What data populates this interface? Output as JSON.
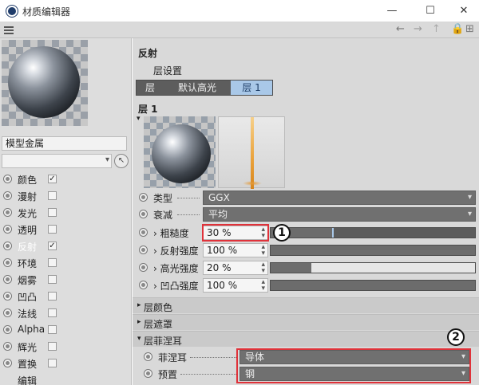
{
  "window": {
    "title": "材质编辑器"
  },
  "toolbar": {
    "back": "←",
    "forward": "→",
    "up": "↑"
  },
  "left": {
    "material_name": "模型金属",
    "channels": [
      {
        "label": "颜色",
        "checked": true
      },
      {
        "label": "漫射",
        "checked": false
      },
      {
        "label": "发光",
        "checked": false
      },
      {
        "label": "透明",
        "checked": false
      },
      {
        "label": "反射",
        "checked": true
      },
      {
        "label": "环境",
        "checked": false
      },
      {
        "label": "烟雾",
        "checked": false
      },
      {
        "label": "凹凸",
        "checked": false
      },
      {
        "label": "法线",
        "checked": false
      },
      {
        "label": "Alpha",
        "checked": false
      },
      {
        "label": "辉光",
        "checked": false
      },
      {
        "label": "置换",
        "checked": false
      },
      {
        "label": "编辑",
        "checked": null
      }
    ]
  },
  "right": {
    "section_title": "反射",
    "layer_settings": "层设置",
    "tabs": [
      {
        "label": "层"
      },
      {
        "label": "默认高光"
      },
      {
        "label": "层 1"
      }
    ],
    "layer_title": "层 1",
    "type": {
      "label": "类型",
      "value": "GGX"
    },
    "falloff": {
      "label": "衰减",
      "value": "平均"
    },
    "roughness": {
      "label": "粗糙度",
      "value": "30 %",
      "fraction": 0.3
    },
    "reflect_strength": {
      "label": "反射强度",
      "value": "100 %",
      "fraction": 1.0
    },
    "spec_strength": {
      "label": "高光强度",
      "value": "20 %",
      "fraction": 0.2
    },
    "bump_strength": {
      "label": "凹凸强度",
      "value": "100 %",
      "fraction": 1.0
    },
    "groups": {
      "layer_color": "层颜色",
      "layer_mask": "层遮罩",
      "layer_fresnel": "层菲涅耳"
    },
    "fresnel": {
      "label": "菲涅耳",
      "value": "导体"
    },
    "preset": {
      "label": "预置",
      "value": "钢"
    },
    "callouts": {
      "one": "1",
      "two": "2"
    }
  },
  "colors": {
    "accent": "#a9c8e8",
    "highlight": "#e0323a"
  }
}
